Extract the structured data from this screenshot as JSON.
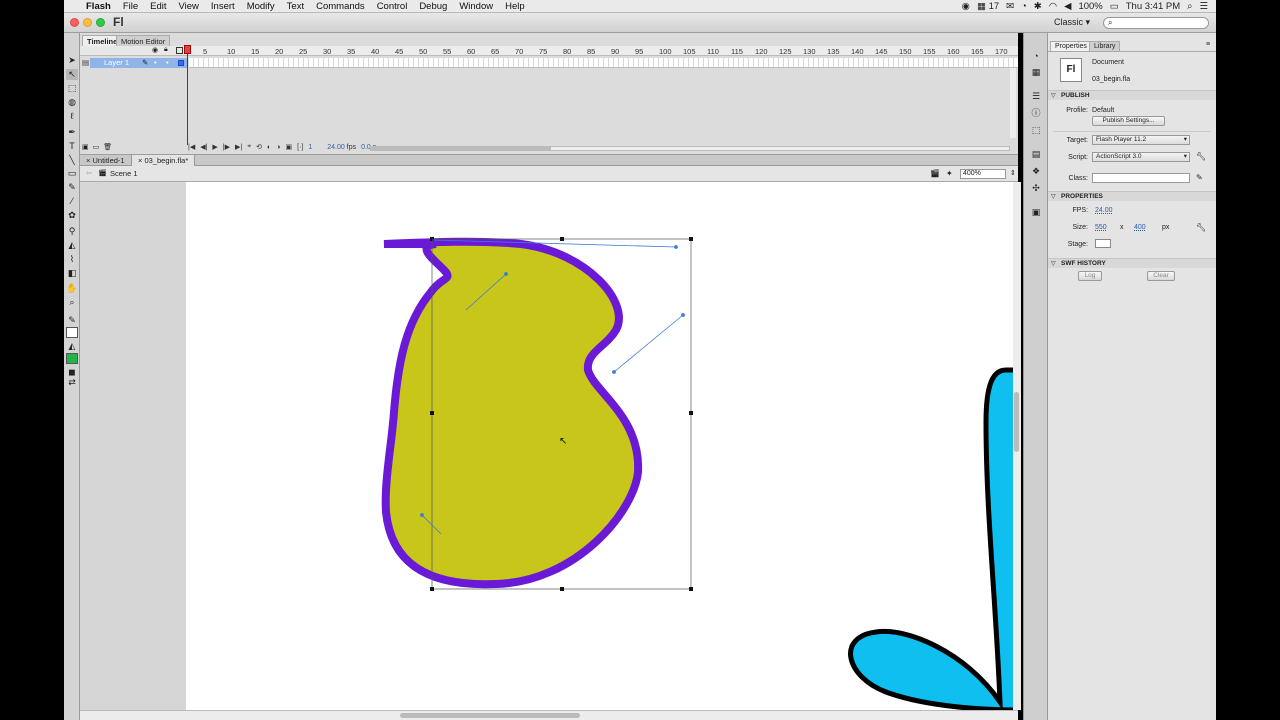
{
  "menubar": {
    "app": "Flash",
    "items": [
      "File",
      "Edit",
      "View",
      "Insert",
      "Modify",
      "Text",
      "Commands",
      "Control",
      "Debug",
      "Window",
      "Help"
    ],
    "battery": "100%",
    "clock": "Thu 3:41 PM",
    "calendar_day": "17"
  },
  "titlebar": {
    "logo": "Fl",
    "workspace": "Classic",
    "search_placeholder": ""
  },
  "timeline": {
    "tabs": [
      "Timeline",
      "Motion Editor"
    ],
    "layer_name": "Layer 1",
    "ruler_ticks": [
      "5",
      "10",
      "15",
      "20",
      "25",
      "30",
      "35",
      "40",
      "45",
      "50",
      "55",
      "60",
      "65",
      "70",
      "75",
      "80",
      "85",
      "90",
      "95",
      "100",
      "105",
      "110",
      "115",
      "120",
      "125",
      "130",
      "135",
      "140",
      "145",
      "150",
      "155",
      "160",
      "165",
      "170"
    ],
    "current_frame": "1",
    "fps": "24.00",
    "fps_unit": "fps",
    "time": "0.0",
    "time_unit": "s"
  },
  "doc_tabs": [
    "Untitled-1",
    "03_begin.fla*"
  ],
  "editbar": {
    "scene": "Scene 1",
    "zoom": "400%"
  },
  "properties": {
    "tabs": [
      "Properties",
      "Library"
    ],
    "doc_icon": "Fl",
    "doc_type": "Document",
    "doc_name": "03_begin.fla",
    "publish_header": "PUBLISH",
    "profile_label": "Profile:",
    "profile_value": "Default",
    "publish_settings_btn": "Publish Settings...",
    "target_label": "Target:",
    "target_value": "Flash Player 11.2",
    "script_label": "Script:",
    "script_value": "ActionScript 3.0",
    "class_label": "Class:",
    "properties_header": "PROPERTIES",
    "fps_label": "FPS:",
    "fps_value": "24.00",
    "size_label": "Size:",
    "size_w": "550",
    "size_x": "x",
    "size_h": "400",
    "size_unit": "px",
    "stage_label": "Stage:",
    "swf_header": "SWF HISTORY",
    "log_btn": "Log",
    "clear_btn": "Clear"
  },
  "colors": {
    "shape_fill": "#c8c61a",
    "shape_stroke": "#6a19d6",
    "second_shape_fill": "#0fbff0",
    "second_shape_stroke": "#000000",
    "stage_background": "#ffffff",
    "pasteboard": "#d6d6d6",
    "selection_layer": "#8fb5e8"
  }
}
